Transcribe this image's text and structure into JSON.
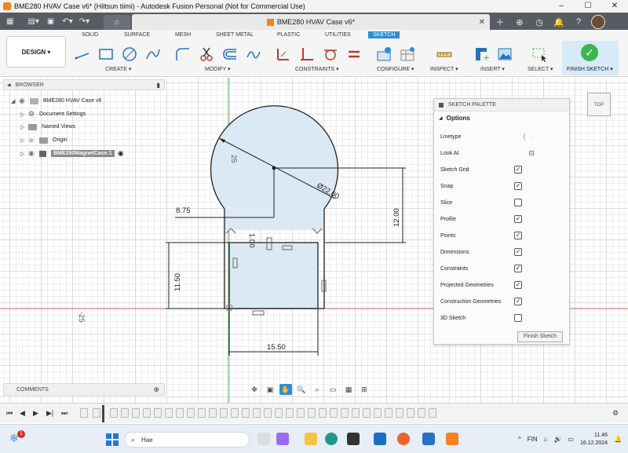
{
  "window": {
    "title": "BME280 HVAV Case v6* (Hiltsun tiimi) - Autodesk Fusion Personal (Not for Commercial Use)",
    "controls": [
      "–",
      "☐",
      "✕"
    ]
  },
  "doc_tab": {
    "title": "BME280 HVAV Case v6*",
    "close": "✕"
  },
  "workspace_button": "DESIGN ▾",
  "ribbon_tabs": [
    "SOLID",
    "SURFACE",
    "MESH",
    "SHEET METAL",
    "PLASTIC",
    "UTILITIES",
    "SKETCH"
  ],
  "ribbon_active_tab": "SKETCH",
  "ribbon_groups": [
    "CREATE ▾",
    "MODIFY ▾",
    "CONSTRAINTS ▾",
    "CONFIGURE ▾",
    "INSPECT ▾",
    "INSERT ▾",
    "SELECT ▾"
  ],
  "finish_sketch_label": "FINISH SKETCH ▾",
  "browser": {
    "title": "BROWSER",
    "items": [
      {
        "label": "BME280 HVAV Case v6"
      },
      {
        "label": "Document Settings"
      },
      {
        "label": "Named Views"
      },
      {
        "label": "Origin"
      },
      {
        "label": "BME280MagnetCase:1"
      }
    ]
  },
  "palette": {
    "title": "SKETCH PALETTE",
    "section": "Options",
    "options": [
      {
        "label": "Linetype",
        "type": "icons"
      },
      {
        "label": "Look At",
        "type": "icon"
      },
      {
        "label": "Sketch Grid",
        "checked": true
      },
      {
        "label": "Snap",
        "checked": true
      },
      {
        "label": "Slice",
        "checked": false
      },
      {
        "label": "Profile",
        "checked": true
      },
      {
        "label": "Points",
        "checked": true
      },
      {
        "label": "Dimensions",
        "checked": true
      },
      {
        "label": "Constraints",
        "checked": true
      },
      {
        "label": "Projected Geometries",
        "checked": true
      },
      {
        "label": "Construction Geometries",
        "checked": true
      },
      {
        "label": "3D Sketch",
        "checked": false
      }
    ],
    "finish_button": "Finish Sketch"
  },
  "viewcube": "TOP",
  "sketch_dimensions": {
    "radius_label": "25",
    "diameter_label": "Ø22.00",
    "horizontal_offset": "8.75",
    "vertical_height": "12.00",
    "small_gap": "1.00",
    "box_height": "11.50",
    "box_width": "15.50",
    "axis_label": "-25"
  },
  "comments": {
    "title": "COMMENTS"
  },
  "taskbar": {
    "search_placeholder": "Hae",
    "notification_count": "1",
    "language": "FIN",
    "time": "11.46",
    "date": "16.12.2024"
  }
}
